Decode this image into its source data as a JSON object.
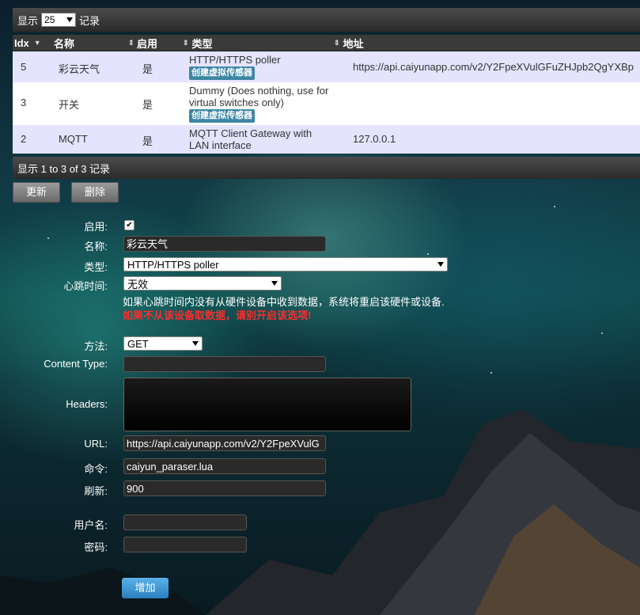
{
  "top": {
    "show_label": "显示",
    "page_size": "25",
    "records_label": "记录"
  },
  "table": {
    "headers": [
      "Idx",
      "名称",
      "启用",
      "类型",
      "地址"
    ],
    "rows": [
      {
        "idx": "5",
        "name": "彩云天气",
        "enabled": "是",
        "type": "HTTP/HTTPS poller",
        "badge": "创建虚拟传感器",
        "address": "https://api.caiyunapp.com/v2/Y2FpeXVulGFuZHJpb2QgYXBp"
      },
      {
        "idx": "3",
        "name": "开关",
        "enabled": "是",
        "type_line1": "Dummy (Does nothing, use for",
        "type_line2": "virtual switches only)",
        "badge": "创建虚拟传感器",
        "address": ""
      },
      {
        "idx": "2",
        "name": "MQTT",
        "enabled": "是",
        "type_line1": "MQTT Client Gateway with",
        "type_line2": "LAN interface",
        "address": "127.0.0.1"
      }
    ],
    "footer": "显示 1 to 3 of 3 记录"
  },
  "actions": {
    "update": "更新",
    "delete": "删除"
  },
  "form": {
    "enabled_label": "启用:",
    "enabled_checked": true,
    "name_label": "名称:",
    "name_value": "彩云天气",
    "type_label": "类型:",
    "type_value": "HTTP/HTTPS poller",
    "heartbeat_label": "心跳时间:",
    "heartbeat_value": "无效",
    "heartbeat_note": "如果心跳时间内没有从硬件设备中收到数据，系统将重启该硬件或设备.",
    "heartbeat_warning": "如果不从该设备取数据，请别开启该选项!",
    "method_label": "方法:",
    "method_value": "GET",
    "content_type_label": "Content Type:",
    "content_type_value": "",
    "headers_label": "Headers:",
    "url_label": "URL:",
    "url_value": "https://api.caiyunapp.com/v2/Y2FpeXVulG",
    "command_label": "命令:",
    "command_value": "caiyun_paraser.lua",
    "refresh_label": "刷新:",
    "refresh_value": "900",
    "username_label": "用户名:",
    "username_value": "",
    "password_label": "密码:",
    "password_value": "",
    "add_button": "增加"
  },
  "icons": {
    "sort": "sort-icon",
    "dropdown": "chevron-down-icon",
    "check": "checkmark-icon"
  }
}
